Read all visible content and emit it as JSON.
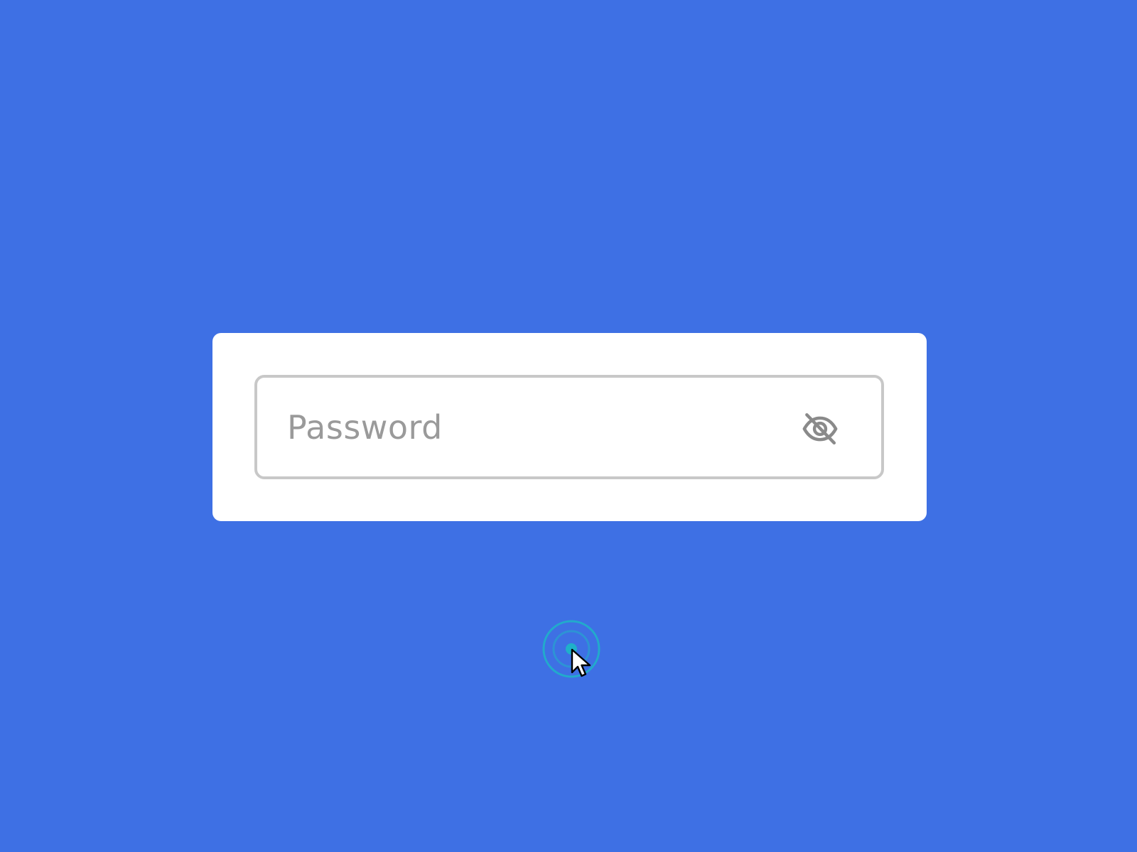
{
  "page": {
    "background_color": "#3e70e4"
  },
  "password_field": {
    "placeholder": "Password",
    "value": "",
    "border_color": "#c8c8c8",
    "placeholder_color": "#9a9a9a"
  },
  "visibility_toggle": {
    "icon": "eye-off-icon",
    "icon_color": "#8a8a8a"
  },
  "pointer": {
    "icon": "mouse-pointer-icon",
    "ripple_icon": "click-ripple-icon",
    "ripple_color": "#1fb0c9"
  }
}
